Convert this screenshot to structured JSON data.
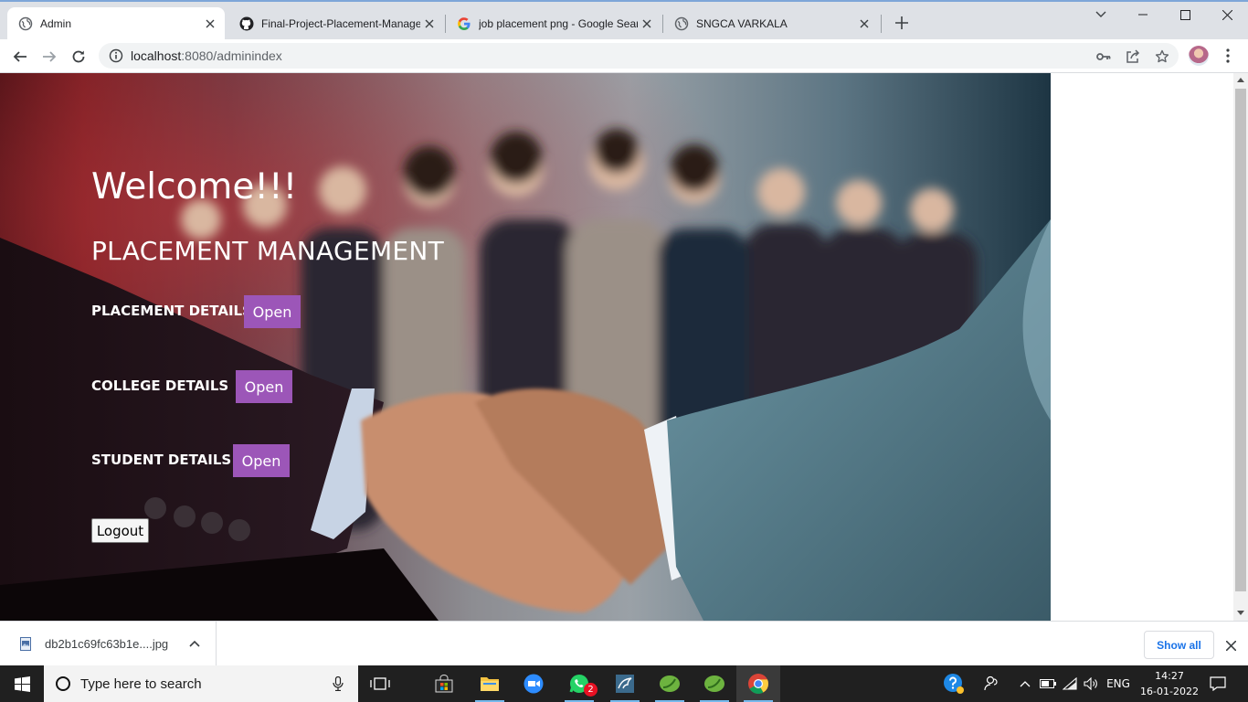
{
  "browser": {
    "tabs": [
      {
        "title": "Admin",
        "icon": "globe-icon",
        "active": true
      },
      {
        "title": "Final-Project-Placement-Manage",
        "icon": "github-icon",
        "active": false
      },
      {
        "title": "job placement png - Google Sear",
        "icon": "google-icon",
        "active": false
      },
      {
        "title": "SNGCA VARKALA",
        "icon": "globe-icon",
        "active": false
      }
    ],
    "url_host": "localhost",
    "url_rest": ":8080/adminindex"
  },
  "page": {
    "welcome": "Welcome!!!",
    "title": "PLACEMENT MANAGEMENT",
    "sections": [
      {
        "label": "PLACEMENT DETAILS",
        "button": "Open"
      },
      {
        "label": "COLLEGE DETAILS",
        "button": "Open"
      },
      {
        "label": "STUDENT DETAILS",
        "button": "Open"
      }
    ],
    "logout": "Logout",
    "accent_color": "#9c56b8"
  },
  "downloads": {
    "file_name": "db2b1c69fc63b1e....jpg",
    "show_all": "Show all"
  },
  "taskbar": {
    "search_placeholder": "Type here to search",
    "whatsapp_badge": "2",
    "language": "ENG",
    "time": "14:27",
    "date": "16-01-2022"
  }
}
